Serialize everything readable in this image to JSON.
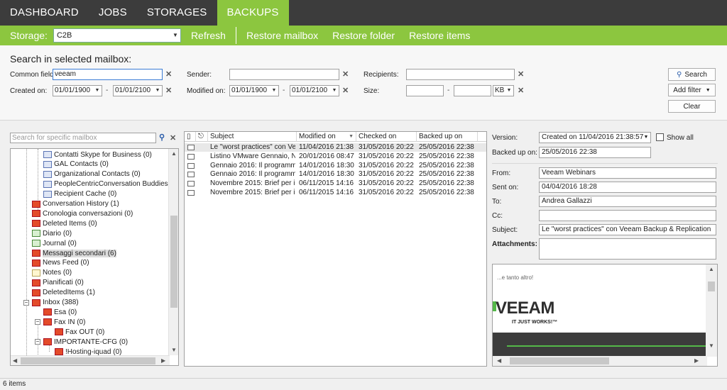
{
  "nav": {
    "tabs": [
      {
        "label": "DASHBOARD"
      },
      {
        "label": "JOBS"
      },
      {
        "label": "STORAGES"
      },
      {
        "label": "BACKUPS"
      }
    ]
  },
  "toolbar": {
    "storage_label": "Storage:",
    "storage_value": "C2B",
    "refresh": "Refresh",
    "restore_mailbox": "Restore mailbox",
    "restore_folder": "Restore folder",
    "restore_items": "Restore items"
  },
  "search": {
    "title": "Search in selected mailbox:",
    "common_fields_label": "Common fields:",
    "common_fields_value": "veeam",
    "sender_label": "Sender:",
    "recipients_label": "Recipients:",
    "created_on_label": "Created on:",
    "created_from": "01/01/1900",
    "created_to": "01/01/2100",
    "modified_on_label": "Modified on:",
    "modified_from": "01/01/1900",
    "modified_to": "01/01/2100",
    "size_label": "Size:",
    "size_unit": "KB",
    "dash": "-",
    "search_button": "Search",
    "add_filter_button": "Add filter",
    "clear_button": "Clear"
  },
  "mailbox_search": {
    "placeholder": "Search for specific mailbox"
  },
  "tree": {
    "items": [
      {
        "label": "Contatti Skype for Business (0)",
        "icon": "contact"
      },
      {
        "label": "GAL Contacts (0)",
        "icon": "contact"
      },
      {
        "label": "Organizational Contacts (0)",
        "icon": "contact"
      },
      {
        "label": "PeopleCentricConversation Buddies (0)",
        "icon": "contact"
      },
      {
        "label": "Recipient Cache (0)",
        "icon": "contact"
      },
      {
        "label": "Conversation History (1)",
        "icon": "mail"
      },
      {
        "label": "Cronologia conversazioni (0)",
        "icon": "mail"
      },
      {
        "label": "Deleted Items (0)",
        "icon": "mail"
      },
      {
        "label": "Diario (0)",
        "icon": "journal"
      },
      {
        "label": "Journal (0)",
        "icon": "journal"
      },
      {
        "label": "Messaggi secondari (6)",
        "icon": "mail"
      },
      {
        "label": "News Feed (0)",
        "icon": "mail"
      },
      {
        "label": "Notes (0)",
        "icon": "note"
      },
      {
        "label": "Pianificati (0)",
        "icon": "mail"
      },
      {
        "label": "DeletedItems (1)",
        "icon": "mail"
      },
      {
        "label": "Inbox (388)",
        "icon": "mail"
      },
      {
        "label": "Esa (0)",
        "icon": "mail"
      },
      {
        "label": "Fax IN (0)",
        "icon": "mail"
      },
      {
        "label": "Fax OUT (0)",
        "icon": "mail"
      },
      {
        "label": "IMPORTANTE-CFG (0)",
        "icon": "mail"
      },
      {
        "label": "!Hosting-iquad (0)",
        "icon": "mail"
      }
    ]
  },
  "grid": {
    "columns": [
      "Subject",
      "Modified on",
      "Checked on",
      "Backed up on"
    ],
    "rows": [
      {
        "subject": "Le \"worst practices\" con Veea...",
        "modified": "11/04/2016 21:38",
        "checked": "31/05/2016 20:22",
        "backed": "25/05/2016 22:38"
      },
      {
        "subject": "Listino VMware Gennaio, Nuo...",
        "modified": "20/01/2016 08:47",
        "checked": "31/05/2016 20:22",
        "backed": "25/05/2016 22:38"
      },
      {
        "subject": "Gennaio 2016: Il programma V...",
        "modified": "14/01/2016 18:30",
        "checked": "31/05/2016 20:22",
        "backed": "25/05/2016 22:38"
      },
      {
        "subject": "Gennaio 2016: Il programma V...",
        "modified": "14/01/2016 18:30",
        "checked": "31/05/2016 20:22",
        "backed": "25/05/2016 22:38"
      },
      {
        "subject": "Novembre 2015: Brief per i par...",
        "modified": "06/11/2015 14:16",
        "checked": "31/05/2016 20:22",
        "backed": "25/05/2016 22:38"
      },
      {
        "subject": "Novembre 2015: Brief per i par...",
        "modified": "06/11/2015 14:16",
        "checked": "31/05/2016 20:22",
        "backed": "25/05/2016 22:38"
      }
    ]
  },
  "details": {
    "version_label": "Version:",
    "version_value": "Created on 11/04/2016 21:38:57",
    "show_all_label": "Show all",
    "backed_up_label": "Backed up on:",
    "backed_up_value": "25/05/2016 22:38",
    "from_label": "From:",
    "from_value": "Veeam Webinars",
    "sent_label": "Sent on:",
    "sent_value": "04/04/2016 18:28",
    "to_label": "To:",
    "to_value": "Andrea Gallazzi",
    "cc_label": "Cc:",
    "cc_value": "",
    "subject_label": "Subject:",
    "subject_value": "Le \"worst practices\" con Veeam Backup & Replication",
    "attachments_label": "Attachments:"
  },
  "preview": {
    "small_text": "...e tanto altro!",
    "logo_text": "VEEAM",
    "tagline": "IT JUST WORKS!™"
  },
  "status": {
    "text": "6 items"
  }
}
